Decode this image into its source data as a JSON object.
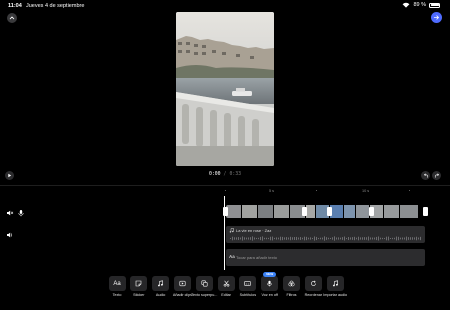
{
  "status_bar": {
    "time": "11:04",
    "date": "Jueves 4 de septiembre",
    "battery": "89 %",
    "battery_level": 0.89
  },
  "playback": {
    "current": "0:00",
    "separator": "/",
    "total": "0:33"
  },
  "ruler": {
    "marks": [
      "5 s",
      "10 s"
    ]
  },
  "tracks": {
    "audio": {
      "title": "La vie en rose · Zaz"
    },
    "text": {
      "icon": "Aa",
      "placeholder": "Tocar para añadir texto"
    }
  },
  "toolbar": {
    "items": [
      {
        "name": "text",
        "label": "Texto"
      },
      {
        "name": "sticker",
        "label": "Sticker"
      },
      {
        "name": "audio",
        "label": "Audio"
      },
      {
        "name": "add-clips",
        "label": "Añadir clips"
      },
      {
        "name": "overlay-text",
        "label": "Texto superpu..."
      },
      {
        "name": "edit",
        "label": "Editar"
      },
      {
        "name": "subtitles",
        "label": "Subtítulos"
      },
      {
        "name": "voice-over",
        "label": "Voz en off",
        "badge": "NEW"
      },
      {
        "name": "filters",
        "label": "Filtros"
      },
      {
        "name": "reorder",
        "label": "Reordenar"
      },
      {
        "name": "import-audio",
        "label": "Importar audio"
      }
    ]
  },
  "colors": {
    "accent": "#4f6bff",
    "badge": "#3b82f6",
    "track_bg": "#2c2c2e",
    "tool_bg": "#262628"
  },
  "icons": {
    "status": [
      "wifi-icon",
      "battery-icon"
    ],
    "top": [
      "chevron-up-icon",
      "arrow-right-icon"
    ],
    "playback": [
      "play-icon",
      "undo-icon",
      "redo-icon"
    ],
    "side": [
      "mute-icon",
      "voice-mic-icon",
      "speaker-icon"
    ]
  }
}
